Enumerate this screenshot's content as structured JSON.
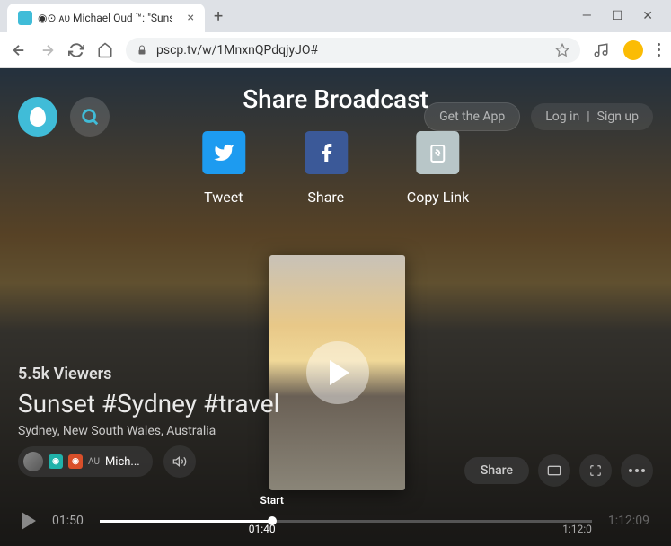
{
  "browser": {
    "tab_title": "◉⊙ ᴀᴜ Michael Oud ™: \"Sunset #...\"",
    "url": "pscp.tv/w/1MnxnQPdqjyJO#",
    "new_tab": "+",
    "close": "×",
    "minimize": "—",
    "maximize": "☐",
    "window_close": "✕"
  },
  "header": {
    "get_app": "Get the App",
    "login": "Log in",
    "signup": "Sign up"
  },
  "modal": {
    "heading": "Share Broadcast",
    "tweet": "Tweet",
    "share": "Share",
    "copy_link": "Copy Link"
  },
  "broadcast": {
    "viewers": "5.5k Viewers",
    "title": "Sunset #Sydney #travel",
    "location": "Sydney, New South Wales, Australia",
    "user": "Mich...",
    "au_badge": "AU"
  },
  "controls": {
    "share": "Share"
  },
  "playback": {
    "current": "01:50",
    "start_label": "Start",
    "start_time": "01:40",
    "end": "1:12:0",
    "duration": "1:12:09"
  }
}
